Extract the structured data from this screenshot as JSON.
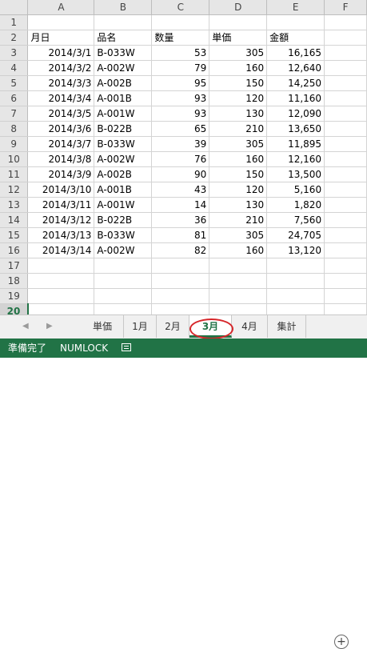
{
  "columns": [
    "A",
    "B",
    "C",
    "D",
    "E",
    "F"
  ],
  "rows": [
    {
      "n": "1",
      "a": "",
      "b": "",
      "c": "",
      "d": "",
      "e": ""
    },
    {
      "n": "2",
      "a": "月日",
      "b": "品名",
      "c": "数量",
      "d": "単価",
      "e": "金額"
    },
    {
      "n": "3",
      "a": "2014/3/1",
      "b": "B-033W",
      "c": "53",
      "d": "305",
      "e": "16,165"
    },
    {
      "n": "4",
      "a": "2014/3/2",
      "b": "A-002W",
      "c": "79",
      "d": "160",
      "e": "12,640"
    },
    {
      "n": "5",
      "a": "2014/3/3",
      "b": "A-002B",
      "c": "95",
      "d": "150",
      "e": "14,250"
    },
    {
      "n": "6",
      "a": "2014/3/4",
      "b": "A-001B",
      "c": "93",
      "d": "120",
      "e": "11,160"
    },
    {
      "n": "7",
      "a": "2014/3/5",
      "b": "A-001W",
      "c": "93",
      "d": "130",
      "e": "12,090"
    },
    {
      "n": "8",
      "a": "2014/3/6",
      "b": "B-022B",
      "c": "65",
      "d": "210",
      "e": "13,650"
    },
    {
      "n": "9",
      "a": "2014/3/7",
      "b": "B-033W",
      "c": "39",
      "d": "305",
      "e": "11,895"
    },
    {
      "n": "10",
      "a": "2014/3/8",
      "b": "A-002W",
      "c": "76",
      "d": "160",
      "e": "12,160"
    },
    {
      "n": "11",
      "a": "2014/3/9",
      "b": "A-002B",
      "c": "90",
      "d": "150",
      "e": "13,500"
    },
    {
      "n": "12",
      "a": "2014/3/10",
      "b": "A-001B",
      "c": "43",
      "d": "120",
      "e": "5,160"
    },
    {
      "n": "13",
      "a": "2014/3/11",
      "b": "A-001W",
      "c": "14",
      "d": "130",
      "e": "1,820"
    },
    {
      "n": "14",
      "a": "2014/3/12",
      "b": "B-022B",
      "c": "36",
      "d": "210",
      "e": "7,560"
    },
    {
      "n": "15",
      "a": "2014/3/13",
      "b": "B-033W",
      "c": "81",
      "d": "305",
      "e": "24,705"
    },
    {
      "n": "16",
      "a": "2014/3/14",
      "b": "A-002W",
      "c": "82",
      "d": "160",
      "e": "13,120"
    },
    {
      "n": "17",
      "a": "",
      "b": "",
      "c": "",
      "d": "",
      "e": ""
    },
    {
      "n": "18",
      "a": "",
      "b": "",
      "c": "",
      "d": "",
      "e": ""
    },
    {
      "n": "19",
      "a": "",
      "b": "",
      "c": "",
      "d": "",
      "e": ""
    },
    {
      "n": "20",
      "a": "",
      "b": "",
      "c": "",
      "d": "",
      "e": ""
    }
  ],
  "active_row": "20",
  "sheet_tabs": [
    "単価",
    "1月",
    "2月",
    "3月",
    "4月",
    "集計"
  ],
  "active_tab": "3月",
  "nav": {
    "prev": "◀",
    "next": "▶"
  },
  "add_sheet_symbol": "+",
  "status": {
    "ready": "準備完了",
    "numlock": "NUMLOCK",
    "macro_icon": "record-macro-icon"
  },
  "colors": {
    "accent": "#217346",
    "highlight": "#d6262a"
  }
}
